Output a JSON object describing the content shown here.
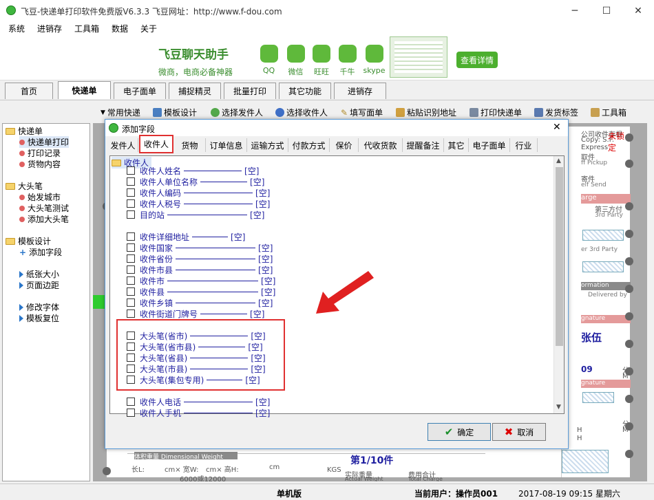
{
  "window": {
    "title": "飞豆-快递单打印软件免费版V6.3.3   飞豆网址：http://www.f-dou.com"
  },
  "menu": [
    "系统",
    "进销存",
    "工具箱",
    "数据",
    "关于"
  ],
  "banner": {
    "title": "飞豆聊天助手",
    "subtitle": "微商，电商必备神器",
    "apps": [
      "QQ",
      "微信",
      "旺旺",
      "千牛",
      "skype"
    ],
    "detail_button": "查看详情"
  },
  "tabs": [
    "首页",
    "快递单",
    "电子面单",
    "捕捉精灵",
    "批量打印",
    "其它功能",
    "进销存"
  ],
  "toolbar": [
    "常用快递",
    "模板设计",
    "选择发件人",
    "选择收件人",
    "填写面单",
    "粘贴识别地址",
    "打印快递单",
    "发货标签",
    "工具箱"
  ],
  "tree": {
    "groups": [
      {
        "label": "快递单",
        "items": [
          "快递单打印",
          "打印记录",
          "货物内容"
        ]
      },
      {
        "label": "大头笔",
        "items": [
          "始发城市",
          "大头笔测试",
          "添加大头笔"
        ]
      },
      {
        "label": "模板设计",
        "items": [
          "添加字段"
        ]
      }
    ],
    "extra": [
      "纸张大小",
      "页面边距",
      "修改字体",
      "模板复位"
    ]
  },
  "canvas": {
    "unlocked": "未锁定",
    "waybill_texts": [
      "公司收件存根",
      "Copy: S.F. Express",
      "取件",
      "ff Pickup",
      "寄件",
      "elf Send",
      "arge",
      "第三方付",
      "3rd Party",
      "er 3rd Party",
      "ormation",
      "Delivered by",
      "gnature",
      "张伍",
      "09",
      "分",
      "M",
      "gnature",
      "分",
      "M",
      "H",
      "H"
    ],
    "page_info": "第1/10件",
    "bottom": {
      "weight_title": "体积重量 Dimensional Weight",
      "length": "长L:",
      "width": "cm× 宽W:",
      "height": "cm× 高H:",
      "unit": "cm",
      "divisor": "6000或12000",
      "kgs": "KGS",
      "actual": "实际重量",
      "actual_en": "Actual Weight",
      "fee": "费用合计",
      "fee_en": "Total Charge"
    }
  },
  "dialog": {
    "title": "添加字段",
    "tabs": [
      "发件人",
      "收件人",
      "货物",
      "订单信息",
      "运输方式",
      "付款方式",
      "保价",
      "代收货款",
      "提醒备注",
      "其它",
      "电子面单",
      "行业"
    ],
    "active_tab": "收件人",
    "folder": "收件人",
    "empty": "[空]",
    "fields": [
      "收件人姓名",
      "收件人单位名称",
      "收件人编码",
      "收件人税号",
      "目的站",
      "收件详细地址",
      "收件国家",
      "收件省份",
      "收件市县",
      "收件市",
      "收件县",
      "收件乡镇",
      "收件街道门牌号",
      "大头笔(省市)",
      "大头笔(省市县)",
      "大头笔(省县)",
      "大头笔(市县)",
      "大头笔(集包专用)",
      "收件人电话",
      "收件人手机"
    ],
    "ok": "确定",
    "cancel": "取消"
  },
  "status": {
    "mode": "单机版",
    "user_label": "当前用户：操作员001",
    "datetime": "2017-08-19 09:15 星期六"
  },
  "colors": {
    "accent": "#3a8d2e",
    "highlight_box": "#e03030",
    "arrow": "#e02020",
    "link": "#1f1fa0"
  }
}
